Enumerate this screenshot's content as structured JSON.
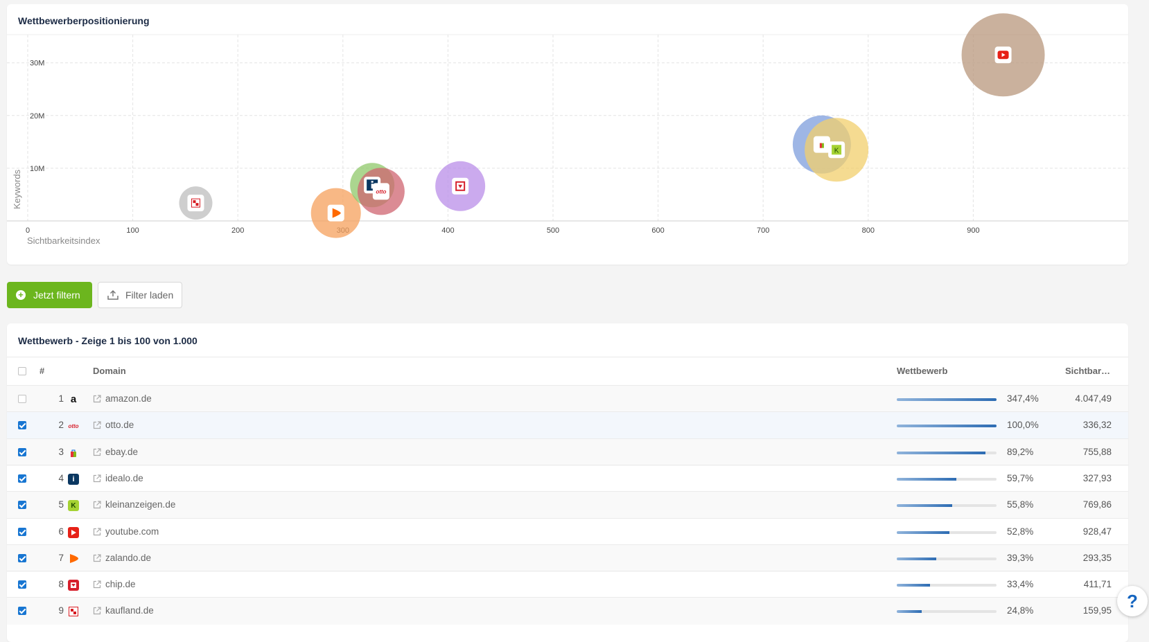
{
  "chart_card": {
    "title": "Wettbewerberpositionierung"
  },
  "chart_data": {
    "type": "scatter",
    "title": "Wettbewerberpositionierung",
    "xlabel": "Sichtbarkeitsindex",
    "ylabel": "Keywords",
    "xlim": [
      0,
      1000
    ],
    "ylim": [
      0,
      35000000
    ],
    "x_ticks": [
      "0",
      "100",
      "200",
      "300",
      "400",
      "500",
      "600",
      "700",
      "800",
      "900"
    ],
    "y_ticks": [
      "10M",
      "20M",
      "30M"
    ],
    "grid": true,
    "points": [
      {
        "domain": "kaufland.de",
        "x": 159.95,
        "y": 3400000,
        "color": "#bdbdbd",
        "icon": "kaufland-icon"
      },
      {
        "domain": "zalando.de",
        "x": 293.35,
        "y": 1500000,
        "color": "#f6a05c",
        "icon": "zalando-icon"
      },
      {
        "domain": "idealo.de",
        "x": 327.93,
        "y": 6800000,
        "color": "#8fc86a",
        "icon": "idealo-icon"
      },
      {
        "domain": "otto.de",
        "x": 336.32,
        "y": 5600000,
        "color": "#cf6470",
        "icon": "otto-icon"
      },
      {
        "domain": "chip.de",
        "x": 411.71,
        "y": 6600000,
        "color": "#b98ee8",
        "icon": "chip-icon"
      },
      {
        "domain": "ebay.de",
        "x": 755.88,
        "y": 14500000,
        "color": "#7e9edc",
        "icon": "ebay-icon"
      },
      {
        "domain": "kleinanzeigen.de",
        "x": 769.86,
        "y": 13500000,
        "color": "#f1cf6c",
        "icon": "kleinanzeigen-icon"
      },
      {
        "domain": "youtube.com",
        "x": 928.47,
        "y": 31500000,
        "color": "#b8977c",
        "icon": "youtube-icon"
      }
    ]
  },
  "actions": {
    "filter_label": "Jetzt filtern",
    "load_label": "Filter laden"
  },
  "table": {
    "title": "Wettbewerb - Zeige 1 bis 100 von 1.000",
    "columns": {
      "num": "#",
      "domain": "Domain",
      "competition": "Wettbewerb",
      "visibility": "Sichtbar…"
    },
    "rows": [
      {
        "num": "1",
        "domain": "amazon.de",
        "competition": "347,4%",
        "bar": 1.0,
        "visibility": "4.047,49",
        "checked": false
      },
      {
        "num": "2",
        "domain": "otto.de",
        "competition": "100,0%",
        "bar": 1.0,
        "visibility": "336,32",
        "checked": true
      },
      {
        "num": "3",
        "domain": "ebay.de",
        "competition": "89,2%",
        "bar": 0.892,
        "visibility": "755,88",
        "checked": true
      },
      {
        "num": "4",
        "domain": "idealo.de",
        "competition": "59,7%",
        "bar": 0.597,
        "visibility": "327,93",
        "checked": true
      },
      {
        "num": "5",
        "domain": "kleinanzeigen.de",
        "competition": "55,8%",
        "bar": 0.558,
        "visibility": "769,86",
        "checked": true
      },
      {
        "num": "6",
        "domain": "youtube.com",
        "competition": "52,8%",
        "bar": 0.528,
        "visibility": "928,47",
        "checked": true
      },
      {
        "num": "7",
        "domain": "zalando.de",
        "competition": "39,3%",
        "bar": 0.393,
        "visibility": "293,35",
        "checked": true
      },
      {
        "num": "8",
        "domain": "chip.de",
        "competition": "33,4%",
        "bar": 0.334,
        "visibility": "411,71",
        "checked": true
      },
      {
        "num": "9",
        "domain": "kaufland.de",
        "competition": "24,8%",
        "bar": 0.248,
        "visibility": "159,95",
        "checked": true
      }
    ]
  },
  "help": {
    "label": "?"
  }
}
